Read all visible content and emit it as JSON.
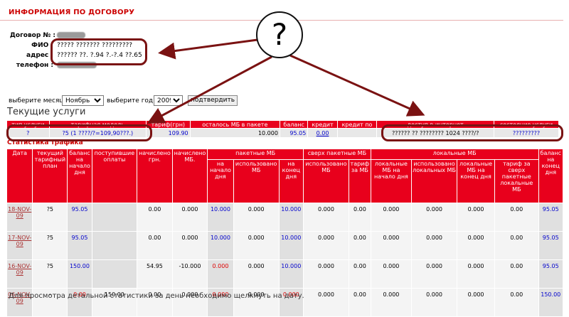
{
  "page": {
    "title": "ИНФОРМАЦИЯ ПО ДОГОВОРУ"
  },
  "contract": {
    "contract_label": "Договор № :",
    "fio_label": "ФИО :",
    "fio_value": "????? ??????? ?????????",
    "address_label": "адрес :",
    "address_value": "?????? ??. ?.94 ?.-?.4 ??.65",
    "phone_label": "телефон :"
  },
  "controls": {
    "month_label": "выберите месяц",
    "month_value": "Ноябрь",
    "year_label": "выберите год",
    "year_value": "2009",
    "submit_label": "подтвердить"
  },
  "services": {
    "title": "Текущие услуги",
    "headers": [
      "тип услуги",
      "тарифная модель",
      "тариф(грн)",
      "осталось МБ в пакете",
      "баланс",
      "кредит",
      "кредит по",
      "доступ в интернет",
      "состояние услуги"
    ],
    "row": [
      "?",
      "?5 (1 ????/?=109,90???.)",
      "109.90",
      "10.000",
      "95.05",
      "0.00",
      "",
      "?????? ?? ???????? 1024 ????/?",
      "?????????"
    ]
  },
  "stats": {
    "title": "Статистика трафика",
    "headers": {
      "date": "Дата",
      "tariff": "текущий тарифный план",
      "balance_start": "баланс на начало дня",
      "payments": "поступившие оплаты",
      "charged_uah": "начислено грн.",
      "charged_mb": "начислено МБ.",
      "package_group": "пакетные МБ",
      "pkg_start": "на начало дня",
      "pkg_used": "использовано МБ",
      "pkg_end": "на конец дня",
      "over_group": "сверх пакетные МБ",
      "over_used": "использовано МБ",
      "over_tariff": "тариф за МБ",
      "local_group": "локальные МБ",
      "loc_start": "локальные МБ на начало дня",
      "loc_used": "использовано локальных МБ",
      "loc_end": "локальные МБ на конец дня",
      "loc_tariff": "тариф за сверх пакетные локальные МБ",
      "balance_end": "баланс на конец дня"
    },
    "rows": [
      [
        "18-NOV-09",
        "?5",
        "95.05",
        "",
        "0.00",
        "0.000",
        "10.000",
        "0.000",
        "10.000",
        "0.000",
        "0.00",
        "0.000",
        "0.000",
        "0.000",
        "0.00",
        "95.05"
      ],
      [
        "17-NOV-09",
        "?5",
        "95.05",
        "",
        "0.00",
        "0.000",
        "10.000",
        "0.000",
        "10.000",
        "0.000",
        "0.00",
        "0.000",
        "0.000",
        "0.000",
        "0.00",
        "95.05"
      ],
      [
        "16-NOV-09",
        "?5",
        "150.00",
        "",
        "54.95",
        "-10.000",
        "0.000",
        "0.000",
        "10.000",
        "0.000",
        "0.00",
        "0.000",
        "0.000",
        "0.000",
        "0.00",
        "95.05"
      ],
      [
        "06-NOV-09",
        "-",
        "0.00",
        "150.00",
        "0.00",
        "0.000",
        "0.000",
        "0.000",
        "0.000",
        "0.000",
        "0.00",
        "0.000",
        "0.000",
        "0.000",
        "0.00",
        "150.00"
      ]
    ]
  },
  "footer": {
    "note": "Для просмотра детальной статистики за день необходимо щелкнуть на дату."
  },
  "annotation": {
    "question_mark": "?"
  },
  "colors": {
    "header_red": "#e8001c",
    "annotation_dark_red": "#7a1212",
    "link_blue": "#0000cc"
  }
}
